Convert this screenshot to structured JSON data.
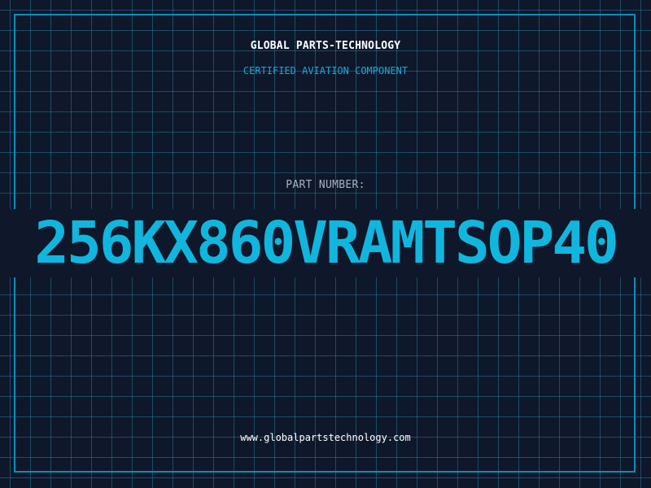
{
  "header": {
    "company": "GLOBAL PARTS-TECHNOLOGY",
    "subtitle": "CERTIFIED AVIATION COMPONENT"
  },
  "part": {
    "label": "PART NUMBER:",
    "number": "256KX860VRAMTSOP40"
  },
  "footer": {
    "url": "www.globalpartstechnology.com"
  },
  "colors": {
    "background": "#0f172a",
    "grid": "#227c96",
    "frame": "#0e8db8",
    "accent": "#10b6de",
    "subtitle": "#17a9d8",
    "label": "#a5b4c6",
    "text": "#ffffff"
  }
}
